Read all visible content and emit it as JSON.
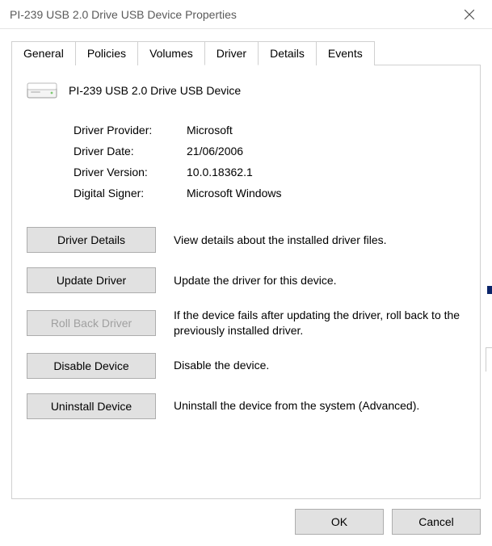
{
  "titlebar": {
    "title": "PI-239 USB 2.0 Drive USB Device Properties"
  },
  "tabs": {
    "general": "General",
    "policies": "Policies",
    "volumes": "Volumes",
    "driver": "Driver",
    "details": "Details",
    "events": "Events"
  },
  "device": {
    "name": "PI-239 USB 2.0 Drive USB Device"
  },
  "info": {
    "provider_label": "Driver Provider:",
    "provider_value": "Microsoft",
    "date_label": "Driver Date:",
    "date_value": "21/06/2006",
    "version_label": "Driver Version:",
    "version_value": "10.0.18362.1",
    "signer_label": "Digital Signer:",
    "signer_value": "Microsoft Windows"
  },
  "actions": {
    "details": {
      "label": "Driver Details",
      "desc": "View details about the installed driver files."
    },
    "update": {
      "label": "Update Driver",
      "desc": "Update the driver for this device."
    },
    "rollback": {
      "label": "Roll Back Driver",
      "desc": "If the device fails after updating the driver, roll back to the previously installed driver."
    },
    "disable": {
      "label": "Disable Device",
      "desc": "Disable the device."
    },
    "uninstall": {
      "label": "Uninstall Device",
      "desc": "Uninstall the device from the system (Advanced)."
    }
  },
  "footer": {
    "ok": "OK",
    "cancel": "Cancel"
  }
}
